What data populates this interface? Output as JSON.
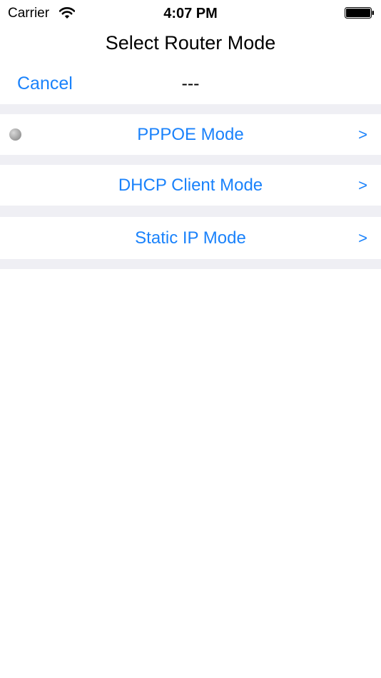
{
  "status_bar": {
    "carrier": "Carrier",
    "time": "4:07 PM"
  },
  "header": {
    "title": "Select Router Mode",
    "cancel_label": "Cancel",
    "selected_mode": "---"
  },
  "modes": [
    {
      "label": "PPPOE Mode",
      "chevron": ">"
    },
    {
      "label": "DHCP Client Mode",
      "chevron": ">"
    },
    {
      "label": "Static IP Mode",
      "chevron": ">"
    }
  ],
  "colors": {
    "accent": "#1a82fb",
    "separator": "#efeff4",
    "indicator": "#a6a6a6"
  },
  "icons": {
    "wifi": "wifi-icon",
    "battery": "battery-icon",
    "indicator": "status-dot-icon"
  }
}
